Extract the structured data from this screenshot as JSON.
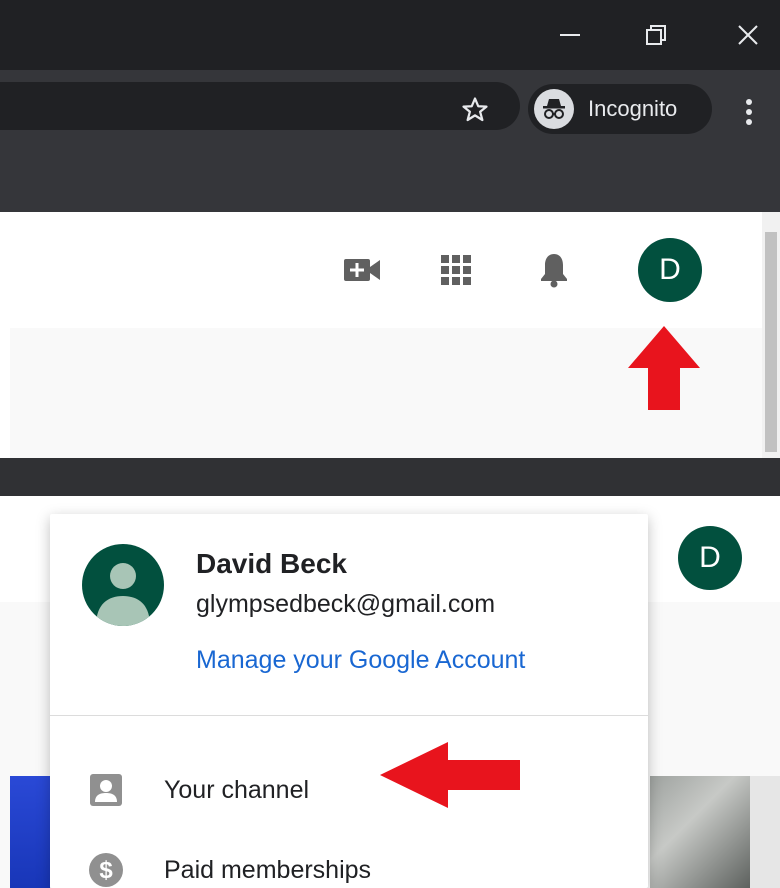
{
  "browser": {
    "incognito_label": "Incognito",
    "icons": [
      "minimize-icon",
      "restore-icon",
      "close-icon",
      "star-icon",
      "incognito-icon",
      "kebab-menu-icon"
    ]
  },
  "youtube_header": {
    "icons": [
      "create-video-icon",
      "apps-grid-icon",
      "notifications-bell-icon"
    ],
    "avatar_letter": "D"
  },
  "account_menu": {
    "name": "David Beck",
    "email": "glympsedbeck@gmail.com",
    "manage_link": "Manage your Google Account",
    "items": [
      {
        "label": "Your channel",
        "icon": "account-box-icon"
      },
      {
        "label": "Paid memberships",
        "icon": "dollar-circle-icon"
      }
    ]
  },
  "colors": {
    "avatar_green": "#02503e",
    "link_blue": "#1967d2",
    "annotation_red": "#e8141d",
    "chrome_dark": "#202124"
  }
}
